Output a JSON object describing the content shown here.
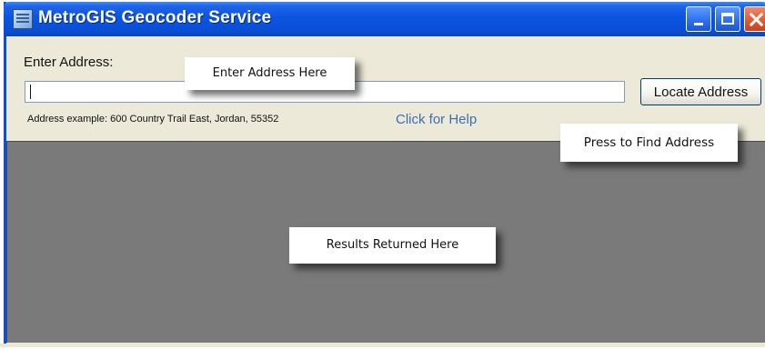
{
  "window": {
    "title": "MetroGIS Geocoder Service",
    "icon": "map-app-icon",
    "controls": [
      "minimize-icon",
      "maximize-icon",
      "close-icon"
    ]
  },
  "form": {
    "address_label": "Enter Address:",
    "address_value": "",
    "locate_button_label": "Locate Address",
    "example_text": "Address example: 600 Country Trail East, Jordan, 55352",
    "help_link_label": "Click for Help"
  },
  "callouts": {
    "enter_address": "Enter Address Here",
    "find_address": "Press to Find Address",
    "results": "Results Returned Here"
  },
  "colors": {
    "titlebar": "#0a4fd6",
    "window_bg": "#ece9d8",
    "results_bg": "#7a7a7a",
    "link": "#3c6eb4",
    "close_button": "#e05a36"
  }
}
